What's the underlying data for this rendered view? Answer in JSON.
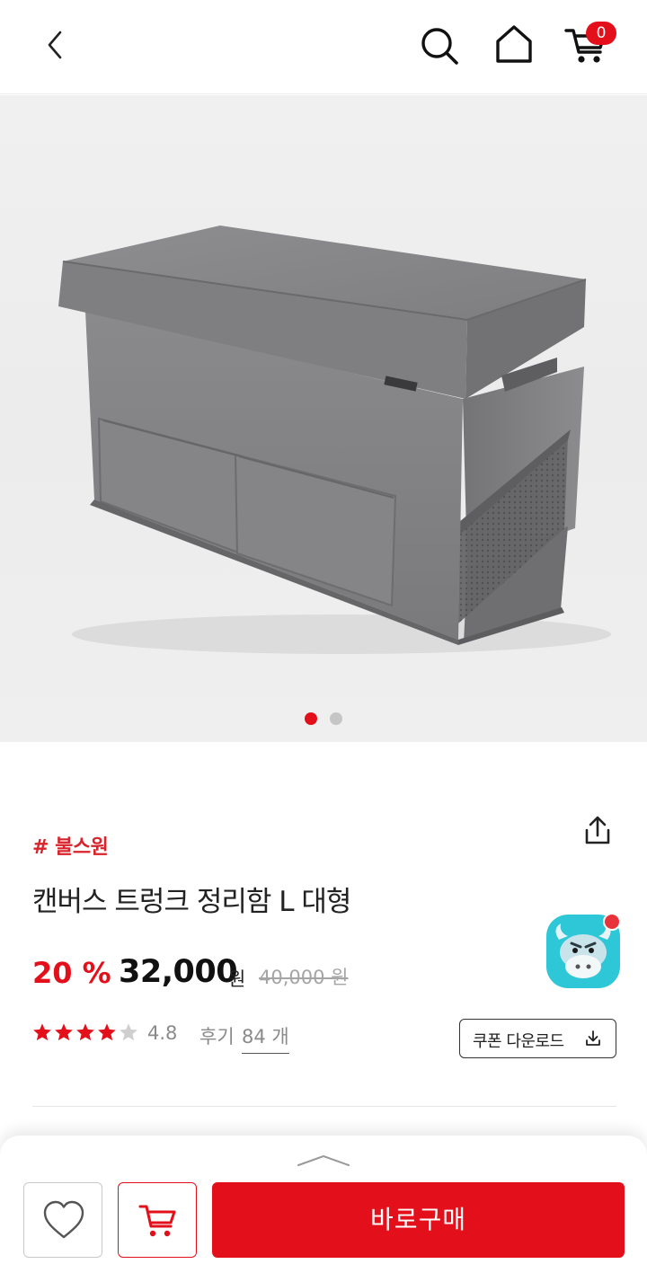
{
  "header": {
    "cart_count": "0",
    "icons": [
      "back-chevron-icon",
      "search-icon",
      "home-icon",
      "cart-icon"
    ]
  },
  "gallery": {
    "image": "gray canvas trunk organizer box with lid and front pockets",
    "current_slide": 1,
    "total_slides": 2
  },
  "product": {
    "brand": "# 불스원",
    "title": "캔버스 트렁크 정리함 L 대형",
    "discount": "20 %",
    "price": "32,000",
    "price_unit": "원",
    "original_price": "40,000 원",
    "rating": "4.8",
    "rating_stars": 4,
    "review_label": "후기",
    "review_count": "84 개",
    "coupon_label": "쿠폰 다운로드"
  },
  "colors": {
    "accent": "#e3101b",
    "brand_text": "#d9222a",
    "muted": "#8a8a8a"
  },
  "bottom_bar": {
    "buy_label": "바로구매"
  }
}
